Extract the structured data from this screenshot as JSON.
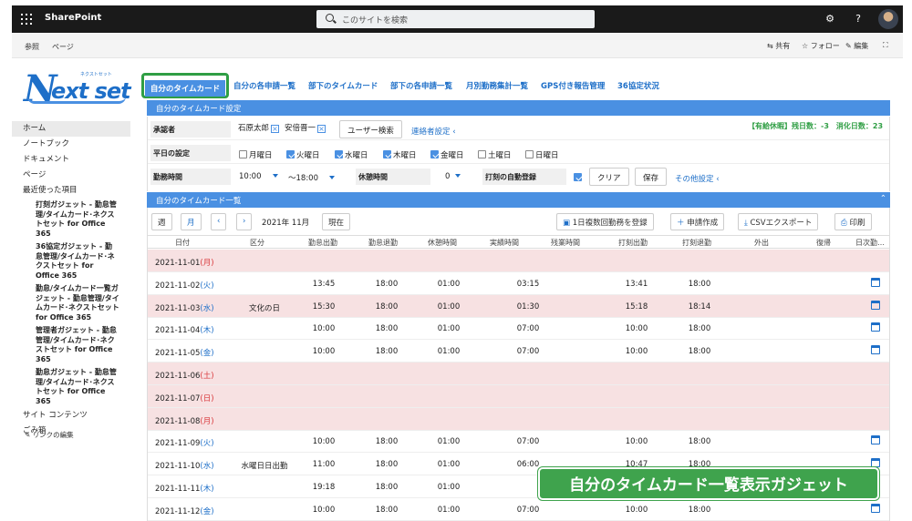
{
  "topbar": {
    "app": "SharePoint",
    "search_placeholder": "このサイトを検索",
    "help": "?"
  },
  "cmdbar": {
    "left": [
      "参照",
      "ページ"
    ],
    "share": "共有",
    "follow": "フォロー",
    "edit": "編集"
  },
  "logo": {
    "name": "Nextset",
    "sub": "ネクストセット"
  },
  "nav": {
    "items": [
      "ホーム",
      "ノートブック",
      "ドキュメント",
      "ページ",
      "最近使った項目"
    ],
    "sub_items": [
      "打刻ガジェット - 勤怠管理/タイムカード･ネクストセット for Office 365",
      "36協定ガジェット - 勤怠管理/タイムカード･ネクストセット for Office 365",
      "勤怠/タイムカード一覧ガジェット - 勤怠管理/タイムカード･ネクストセット for Office 365",
      "管理者ガジェット - 勤怠管理/タイムカード･ネクストセット for Office 365",
      "勤怠ガジェット - 勤怠管理/タイムカード･ネクストセット for Office 365"
    ],
    "tail": [
      "サイト コンテンツ",
      "ごみ箱"
    ],
    "edit_links": "リンクの編集"
  },
  "tabs": [
    "自分のタイムカード",
    "自分の各申請一覧",
    "部下のタイムカード",
    "部下の各申請一覧",
    "月別勤務集計一覧",
    "GPS付き報告管理",
    "36協定状況"
  ],
  "settings": {
    "header": "自分のタイムカード設定",
    "approver_label": "承認者",
    "approvers": [
      "石原太郎",
      "安倍晋一"
    ],
    "user_search": "ユーザー検索",
    "contact_setting": "連絡者設定",
    "leave_info": "【有給休暇】残日数：-3　消化日数：23",
    "weekday_label": "平日の設定",
    "days": [
      {
        "label": "月曜日",
        "on": false
      },
      {
        "label": "火曜日",
        "on": true
      },
      {
        "label": "水曜日",
        "on": true
      },
      {
        "label": "木曜日",
        "on": true
      },
      {
        "label": "金曜日",
        "on": true
      },
      {
        "label": "土曜日",
        "on": false
      },
      {
        "label": "日曜日",
        "on": false
      }
    ],
    "work_time_label": "勤務時間",
    "work_start": "10:00",
    "work_end": "～18:00",
    "break_label": "休憩時間",
    "break_value": "0",
    "auto_stamp_label": "打刻の自動登録",
    "clear": "クリア",
    "save": "保存",
    "other": "その他設定"
  },
  "list": {
    "header": "自分のタイムカード一覧",
    "view_week": "週",
    "view_month": "月",
    "month": "2021年 11月",
    "now": "現在",
    "bulk": "1日複数回勤務を登録",
    "apply": "申請作成",
    "csv": "CSVエクスポート",
    "print": "印刷",
    "columns": [
      "日付",
      "区分",
      "勤怠出勤",
      "勤怠退勤",
      "休憩時間",
      "実績時間",
      "残業時間",
      "打刻出勤",
      "打刻退勤",
      "外出",
      "復帰",
      "日次勤…"
    ],
    "rows": [
      {
        "date": "2021-11-01",
        "wd": "(月)",
        "red": true,
        "hol": true,
        "kubun": "",
        "in": "",
        "out": "",
        "brk": "",
        "act": "",
        "ot": "",
        "sin": "",
        "sout": "",
        "cal": false
      },
      {
        "date": "2021-11-02",
        "wd": "(火)",
        "red": false,
        "hol": false,
        "kubun": "",
        "in": "13:45",
        "out": "18:00",
        "brk": "01:00",
        "act": "03:15",
        "ot": "",
        "sin": "13:41",
        "sout": "18:00",
        "cal": true
      },
      {
        "date": "2021-11-03",
        "wd": "(水)",
        "red": false,
        "hol": true,
        "kubun": "文化の日",
        "in": "15:30",
        "out": "18:00",
        "brk": "01:00",
        "act": "01:30",
        "ot": "",
        "sin": "15:18",
        "sout": "18:14",
        "cal": true
      },
      {
        "date": "2021-11-04",
        "wd": "(木)",
        "red": false,
        "hol": false,
        "kubun": "",
        "in": "10:00",
        "out": "18:00",
        "brk": "01:00",
        "act": "07:00",
        "ot": "",
        "sin": "10:00",
        "sout": "18:00",
        "cal": true
      },
      {
        "date": "2021-11-05",
        "wd": "(金)",
        "red": false,
        "hol": false,
        "kubun": "",
        "in": "10:00",
        "out": "18:00",
        "brk": "01:00",
        "act": "07:00",
        "ot": "",
        "sin": "10:00",
        "sout": "18:00",
        "cal": true
      },
      {
        "date": "2021-11-06",
        "wd": "(土)",
        "red": true,
        "hol": true,
        "kubun": "",
        "in": "",
        "out": "",
        "brk": "",
        "act": "",
        "ot": "",
        "sin": "",
        "sout": "",
        "cal": false
      },
      {
        "date": "2021-11-07",
        "wd": "(日)",
        "red": true,
        "hol": true,
        "kubun": "",
        "in": "",
        "out": "",
        "brk": "",
        "act": "",
        "ot": "",
        "sin": "",
        "sout": "",
        "cal": false
      },
      {
        "date": "2021-11-08",
        "wd": "(月)",
        "red": true,
        "hol": true,
        "kubun": "",
        "in": "",
        "out": "",
        "brk": "",
        "act": "",
        "ot": "",
        "sin": "",
        "sout": "",
        "cal": false
      },
      {
        "date": "2021-11-09",
        "wd": "(火)",
        "red": false,
        "hol": false,
        "kubun": "",
        "in": "10:00",
        "out": "18:00",
        "brk": "01:00",
        "act": "07:00",
        "ot": "",
        "sin": "10:00",
        "sout": "18:00",
        "cal": true
      },
      {
        "date": "2021-11-10",
        "wd": "(水)",
        "red": false,
        "hol": false,
        "kubun": "水曜日日出勤",
        "in": "11:00",
        "out": "18:00",
        "brk": "01:00",
        "act": "06:00",
        "ot": "",
        "sin": "10:47",
        "sout": "18:00",
        "cal": true
      },
      {
        "date": "2021-11-11",
        "wd": "(木)",
        "red": false,
        "hol": false,
        "kubun": "",
        "in": "19:18",
        "out": "18:00",
        "brk": "01:00",
        "act": "",
        "ot": "",
        "sin": "",
        "sout": "",
        "cal": true
      },
      {
        "date": "2021-11-12",
        "wd": "(金)",
        "red": false,
        "hol": false,
        "kubun": "",
        "in": "10:00",
        "out": "18:00",
        "brk": "01:00",
        "act": "07:00",
        "ot": "",
        "sin": "10:00",
        "sout": "18:00",
        "cal": true
      }
    ]
  },
  "badge": "自分のタイムカード一覧表示ガジェット"
}
